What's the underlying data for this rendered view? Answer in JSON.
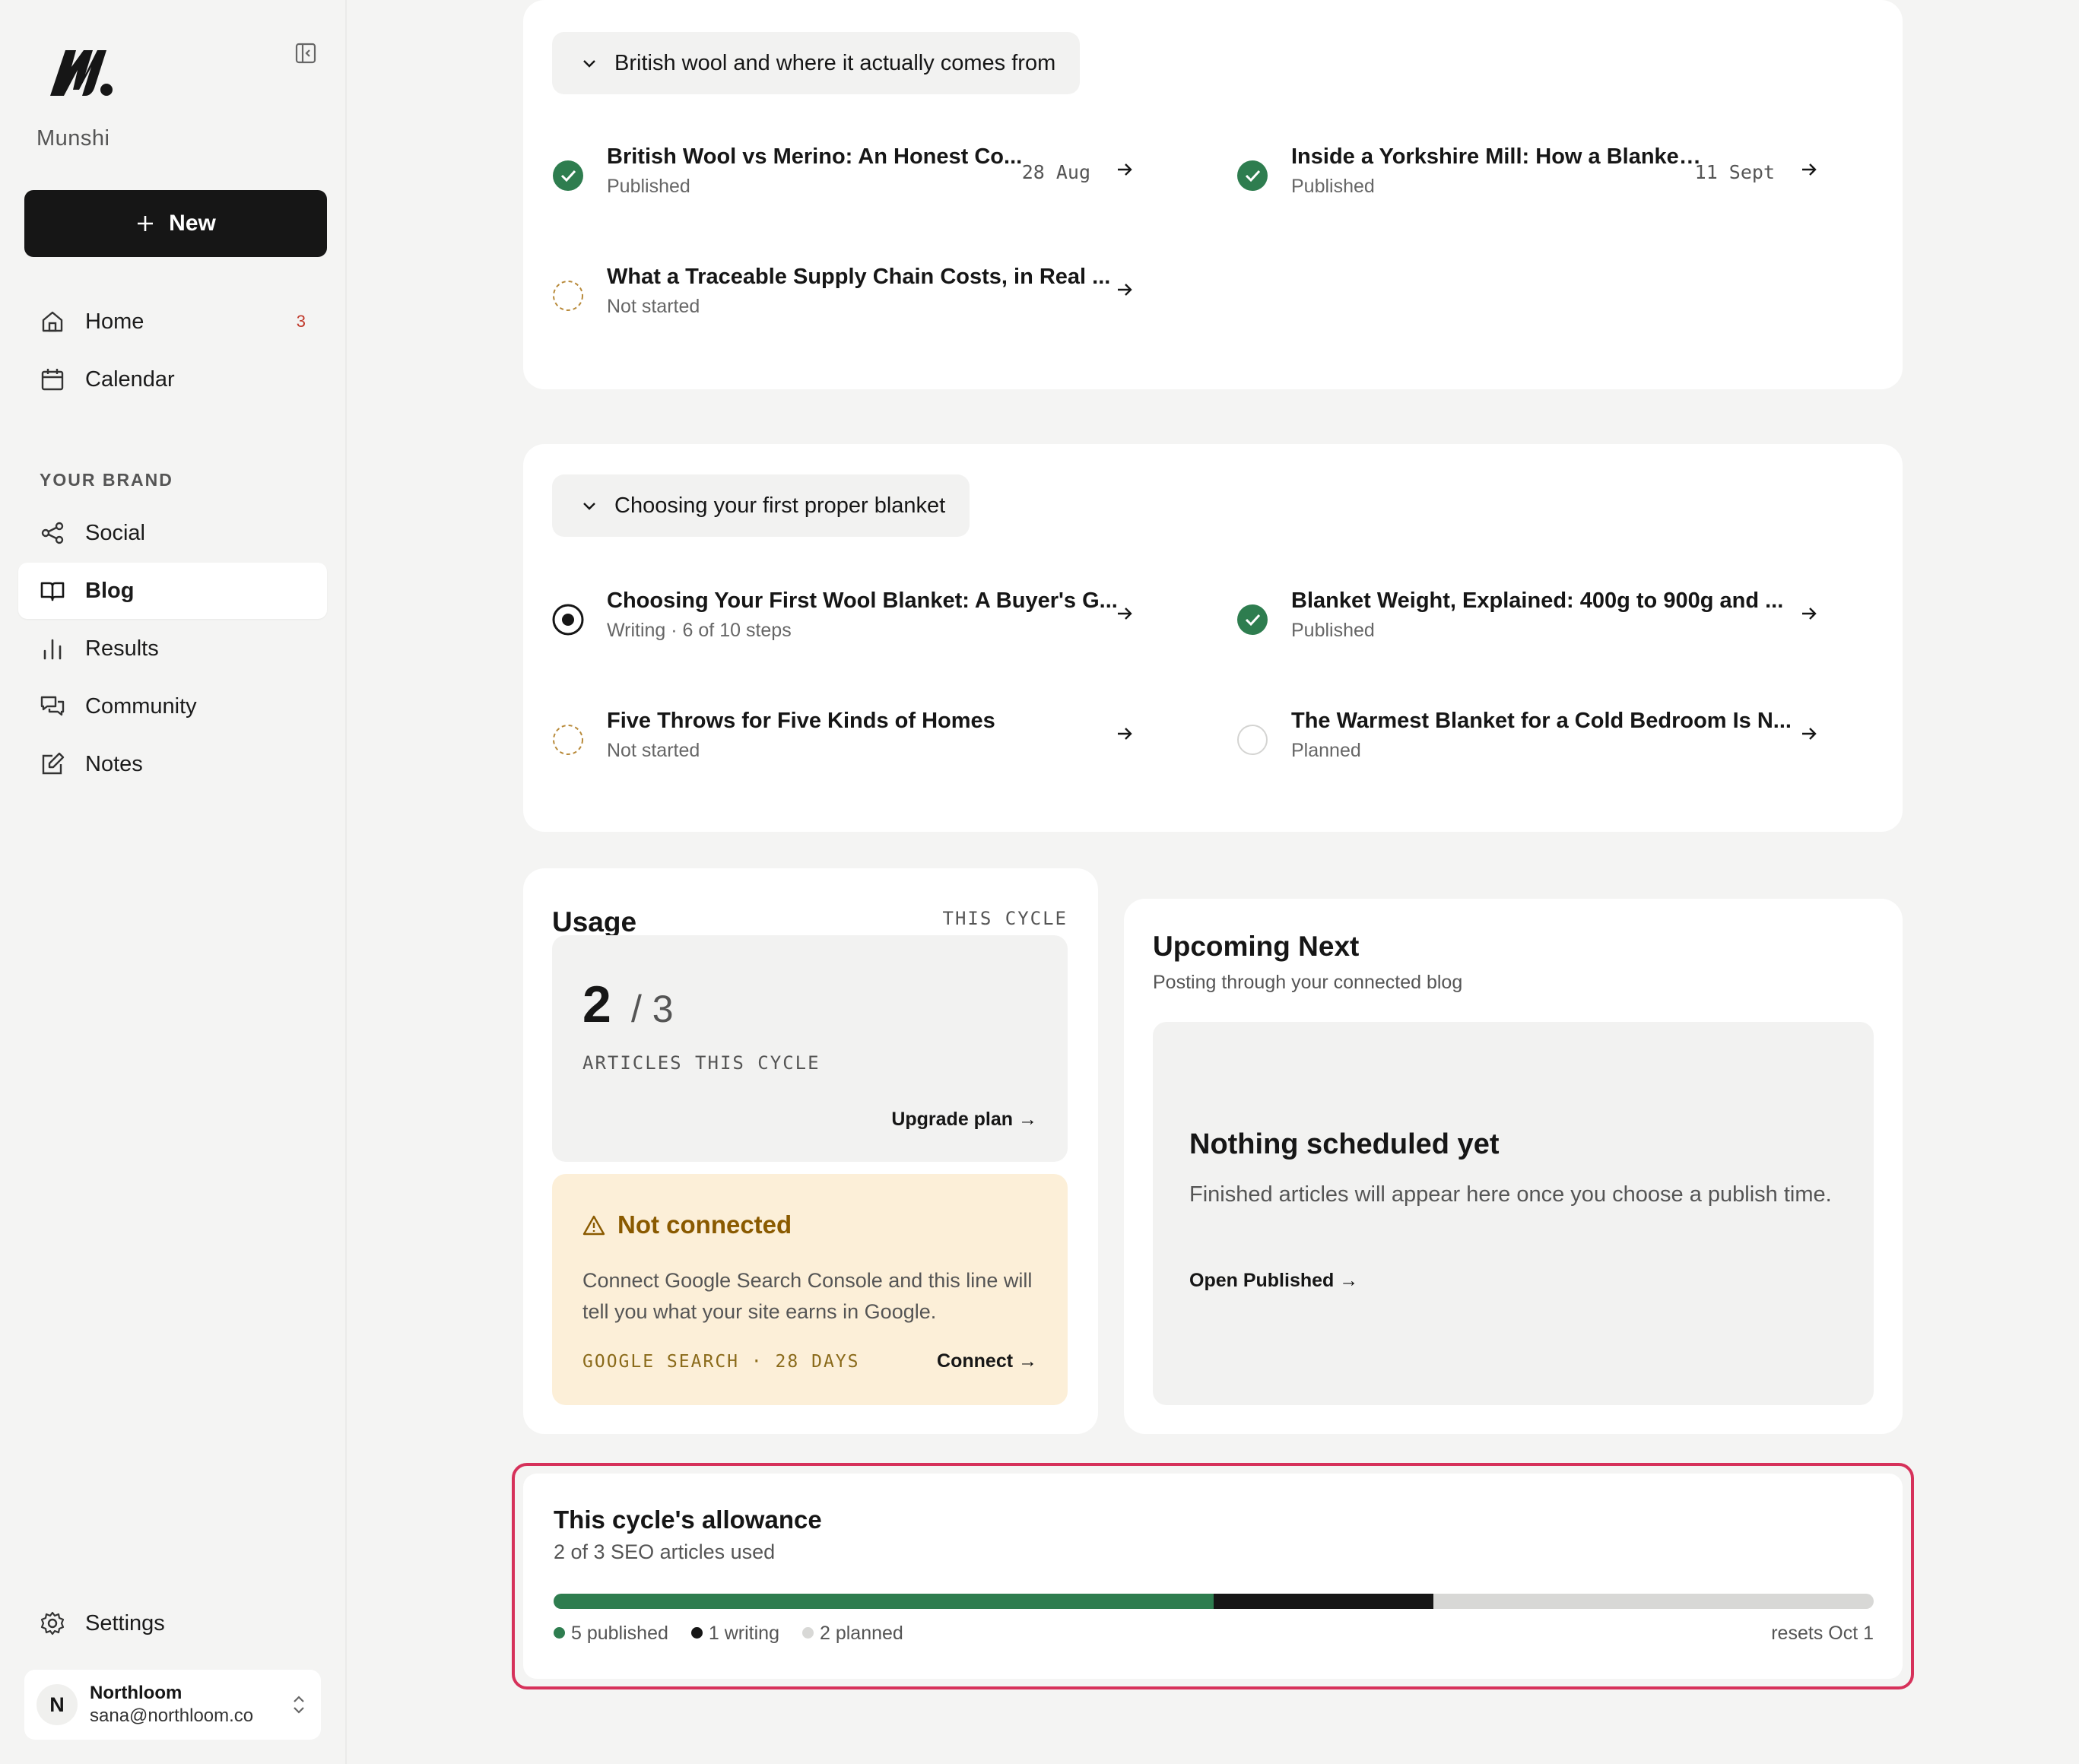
{
  "brand": {
    "name": "Munshi"
  },
  "sidebar": {
    "new_label": "New",
    "items": [
      {
        "label": "Home",
        "badge": "3"
      },
      {
        "label": "Calendar"
      }
    ],
    "section_label": "YOUR BRAND",
    "brand_items": [
      {
        "label": "Social"
      },
      {
        "label": "Blog",
        "active": true
      },
      {
        "label": "Results"
      },
      {
        "label": "Community"
      },
      {
        "label": "Notes"
      }
    ],
    "settings_label": "Settings",
    "account": {
      "initial": "N",
      "name": "Northloom",
      "email": "sana@northloom.co"
    }
  },
  "clusters": [
    {
      "title": "British wool and where it actually comes from",
      "articles": [
        {
          "title": "British Wool vs Merino: An Honest Co...",
          "status": "Published",
          "status_type": "published",
          "date": "28 Aug"
        },
        {
          "title": "Inside a Yorkshire Mill: How a Blanket ...",
          "status": "Published",
          "status_type": "published",
          "date": "11 Sept"
        },
        {
          "title": "What a Traceable Supply Chain Costs, in Real ...",
          "status": "Not started",
          "status_type": "not-started"
        }
      ]
    },
    {
      "title": "Choosing your first proper blanket",
      "articles": [
        {
          "title": "Choosing Your First Wool Blanket: A Buyer's G...",
          "status": "Writing · 6 of 10 steps",
          "status_type": "writing"
        },
        {
          "title": "Blanket Weight, Explained: 400g to 900g and ...",
          "status": "Published",
          "status_type": "published"
        },
        {
          "title": "Five Throws for Five Kinds of Homes",
          "status": "Not started",
          "status_type": "not-started"
        },
        {
          "title": "The Warmest Blanket for a Cold Bedroom Is N...",
          "status": "Planned",
          "status_type": "planned"
        }
      ]
    }
  ],
  "usage": {
    "title": "Usage",
    "cycle_label": "THIS CYCLE",
    "used": "2",
    "total": "/ 3",
    "articles_label": "ARTICLES THIS CYCLE",
    "upgrade_link": "Upgrade plan →",
    "warning": {
      "title": "Not connected",
      "text": "Connect Google Search Console and this line will tell you what your site earns in Google.",
      "source": "GOOGLE SEARCH · 28 DAYS",
      "connect_link": "Connect →"
    }
  },
  "upcoming": {
    "title": "Upcoming Next",
    "subtitle": "Posting through your connected blog",
    "empty_title": "Nothing scheduled yet",
    "empty_text": "Finished articles will appear here once you choose a publish time.",
    "open_link": "Open Published →"
  },
  "allowance": {
    "title": "This cycle's allowance",
    "subtitle": "2 of 3 SEO articles used",
    "segments": [
      {
        "key": "published",
        "fraction": 0.5,
        "color": "#2e7d4f"
      },
      {
        "key": "writing",
        "fraction": 0.1667,
        "color": "#161616"
      }
    ],
    "legend": [
      {
        "label": "5 published",
        "color": "#2e7d4f"
      },
      {
        "label": "1 writing",
        "color": "#161616"
      },
      {
        "label": "2 planned",
        "color": "#d8d8d6"
      }
    ],
    "resets": "resets Oct 1"
  },
  "colors": {
    "accent": "#161616",
    "published": "#2e7d4f",
    "warning_bg": "#fcefd8",
    "warning_text": "#8a5a00",
    "highlight": "#d6315a",
    "badge": "#c0392b"
  }
}
